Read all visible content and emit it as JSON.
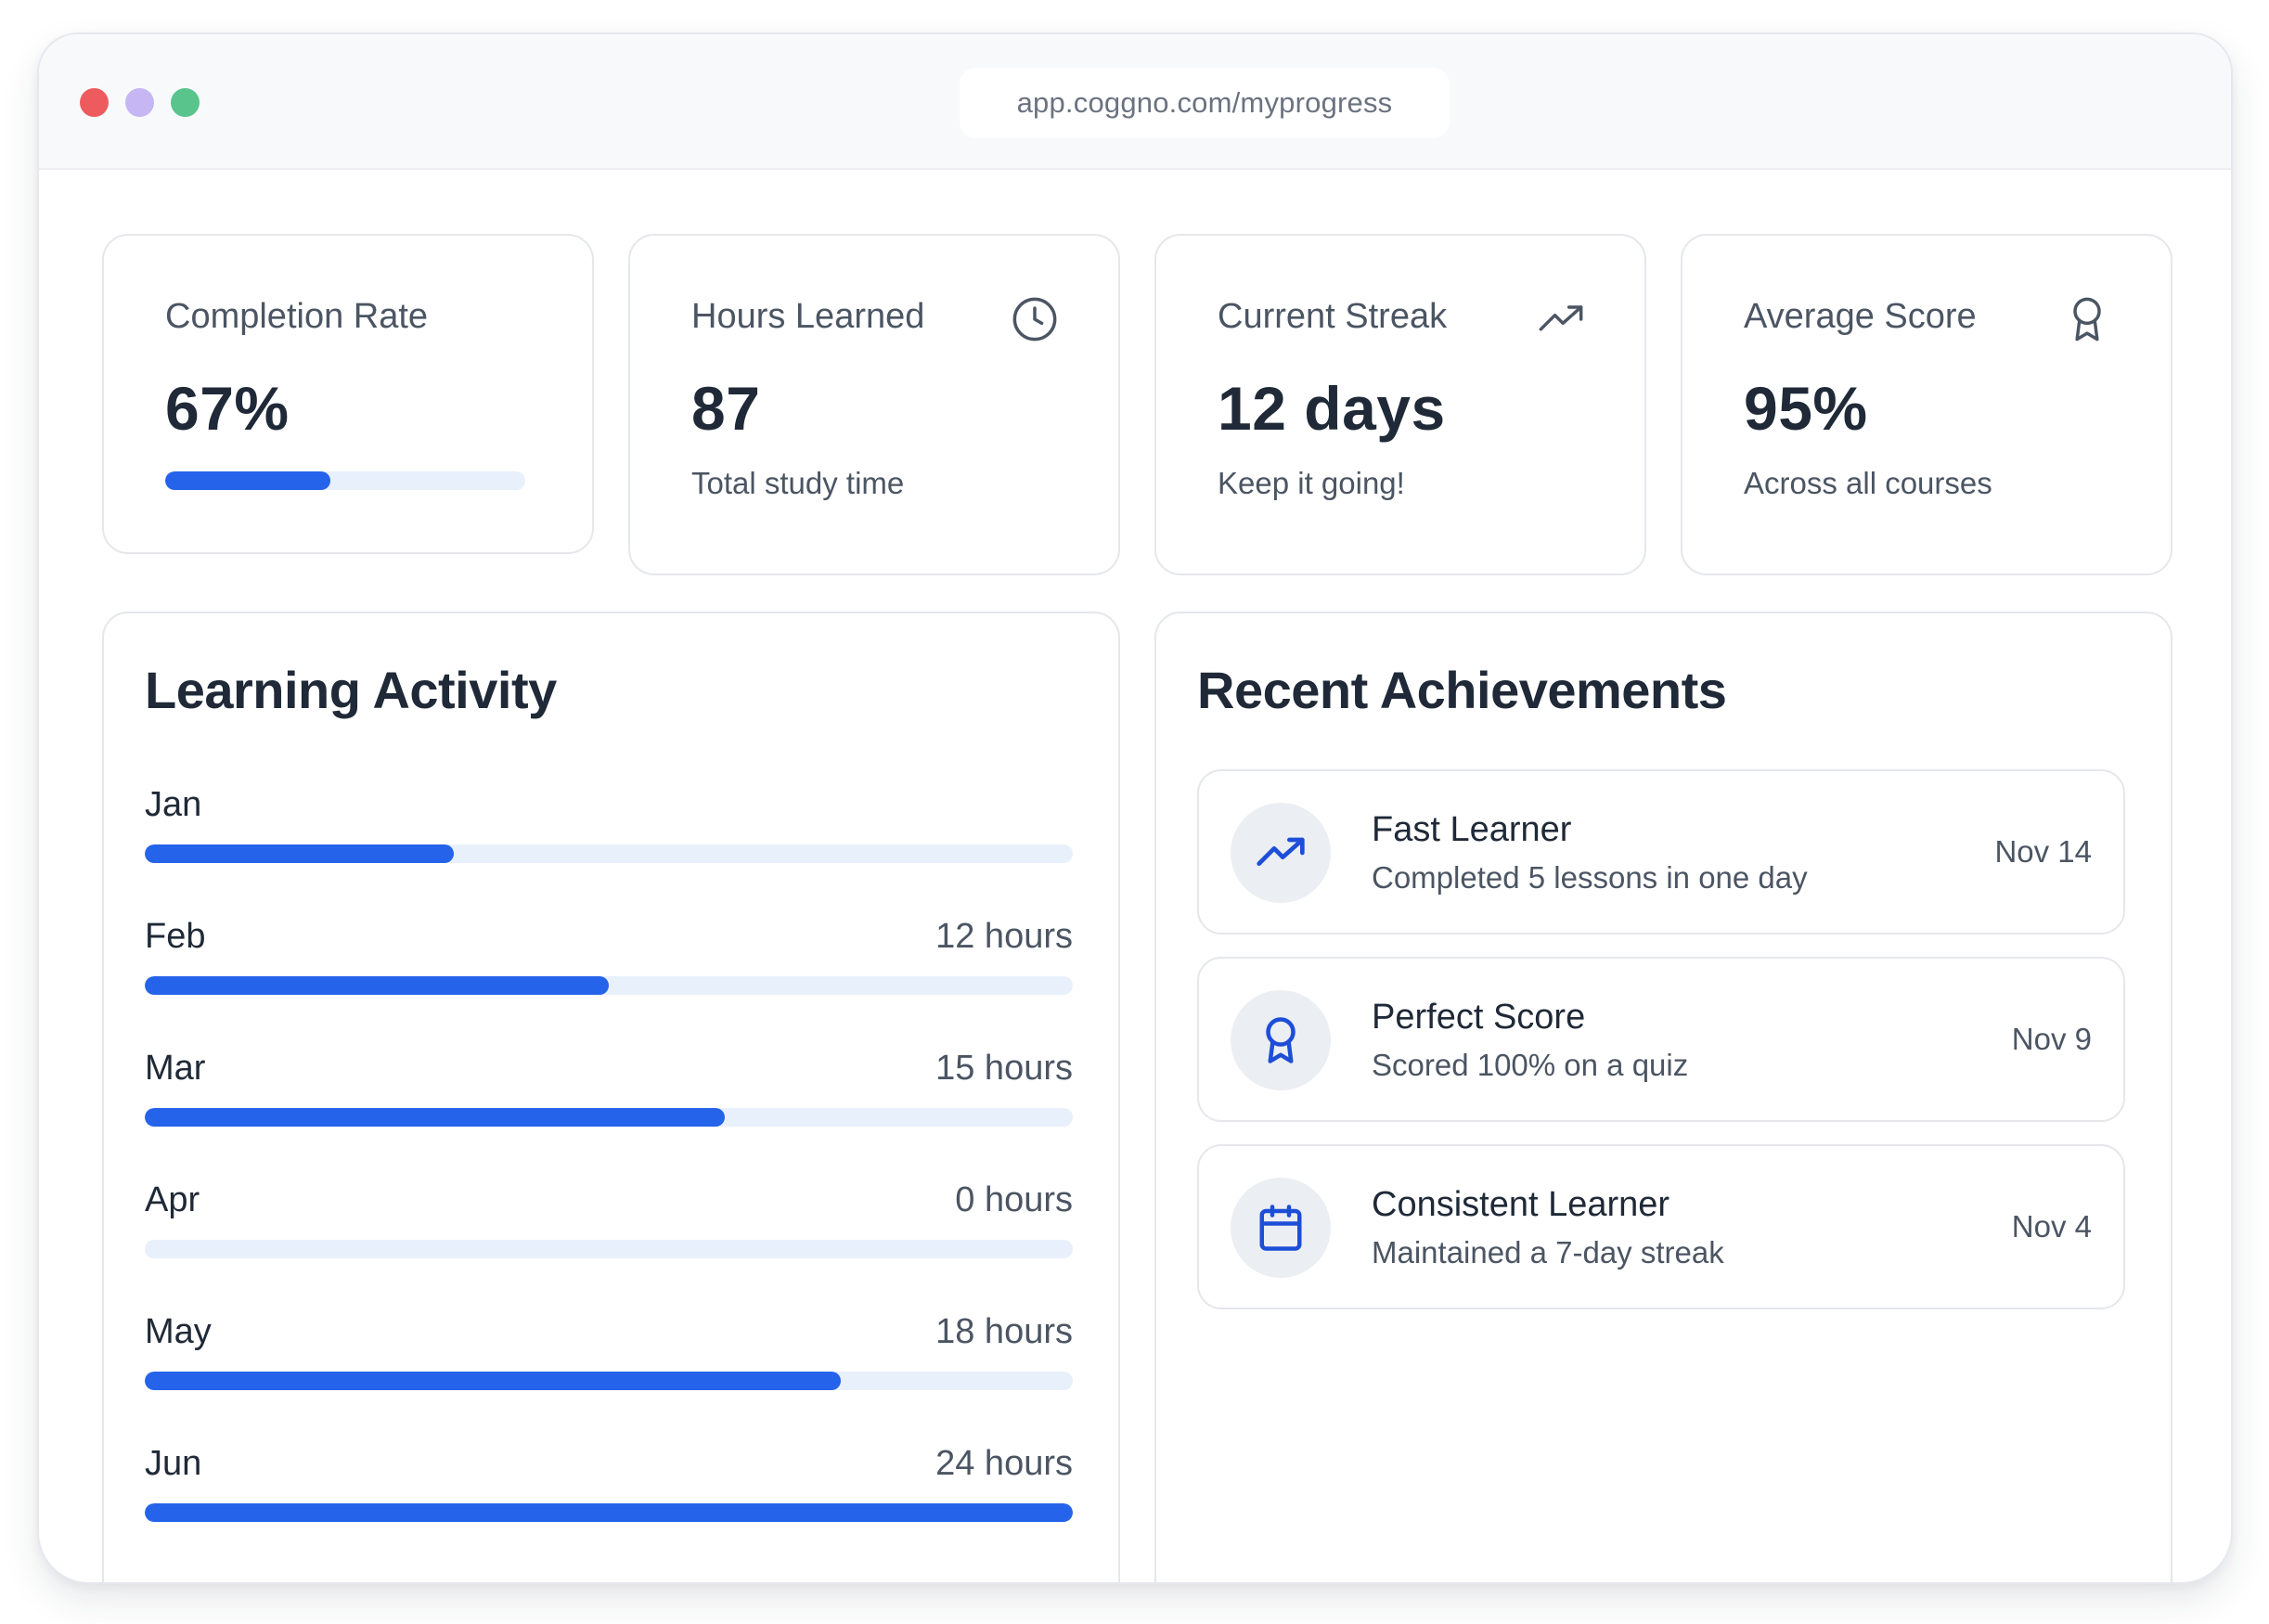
{
  "browser": {
    "url": "app.coggno.com/myprogress"
  },
  "stats": {
    "completion": {
      "label": "Completion Rate",
      "value": "67%",
      "progress_fraction": 0.46
    },
    "hours": {
      "label": "Hours Learned",
      "value": "87",
      "sub": "Total study time",
      "icon": "clock-icon"
    },
    "streak": {
      "label": "Current Streak",
      "value": "12 days",
      "sub": "Keep it going!",
      "icon": "trending-up-icon"
    },
    "score": {
      "label": "Average Score",
      "value": "95%",
      "sub": "Across all courses",
      "icon": "award-icon"
    }
  },
  "activity": {
    "title": "Learning Activity",
    "months": [
      {
        "name": "Jan",
        "hours_label": "",
        "hours": 8
      },
      {
        "name": "Feb",
        "hours_label": "12 hours",
        "hours": 12
      },
      {
        "name": "Mar",
        "hours_label": "15 hours",
        "hours": 15
      },
      {
        "name": "Apr",
        "hours_label": "0 hours",
        "hours": 0
      },
      {
        "name": "May",
        "hours_label": "18 hours",
        "hours": 18
      },
      {
        "name": "Jun",
        "hours_label": "24 hours",
        "hours": 24
      }
    ],
    "max_hours": 24
  },
  "achievements": {
    "title": "Recent Achievements",
    "items": [
      {
        "title": "Fast Learner",
        "description": "Completed 5 lessons in one day",
        "date": "Nov 14",
        "icon": "trending-up-icon"
      },
      {
        "title": "Perfect Score",
        "description": "Scored 100% on a quiz",
        "date": "Nov 9",
        "icon": "award-icon"
      },
      {
        "title": "Consistent Learner",
        "description": "Maintained a 7-day streak",
        "date": "Nov 4",
        "icon": "calendar-icon"
      }
    ]
  },
  "colors": {
    "accent": "#2563eb",
    "track": "#e8f0fc",
    "icon_blue": "#1d4ed8"
  }
}
